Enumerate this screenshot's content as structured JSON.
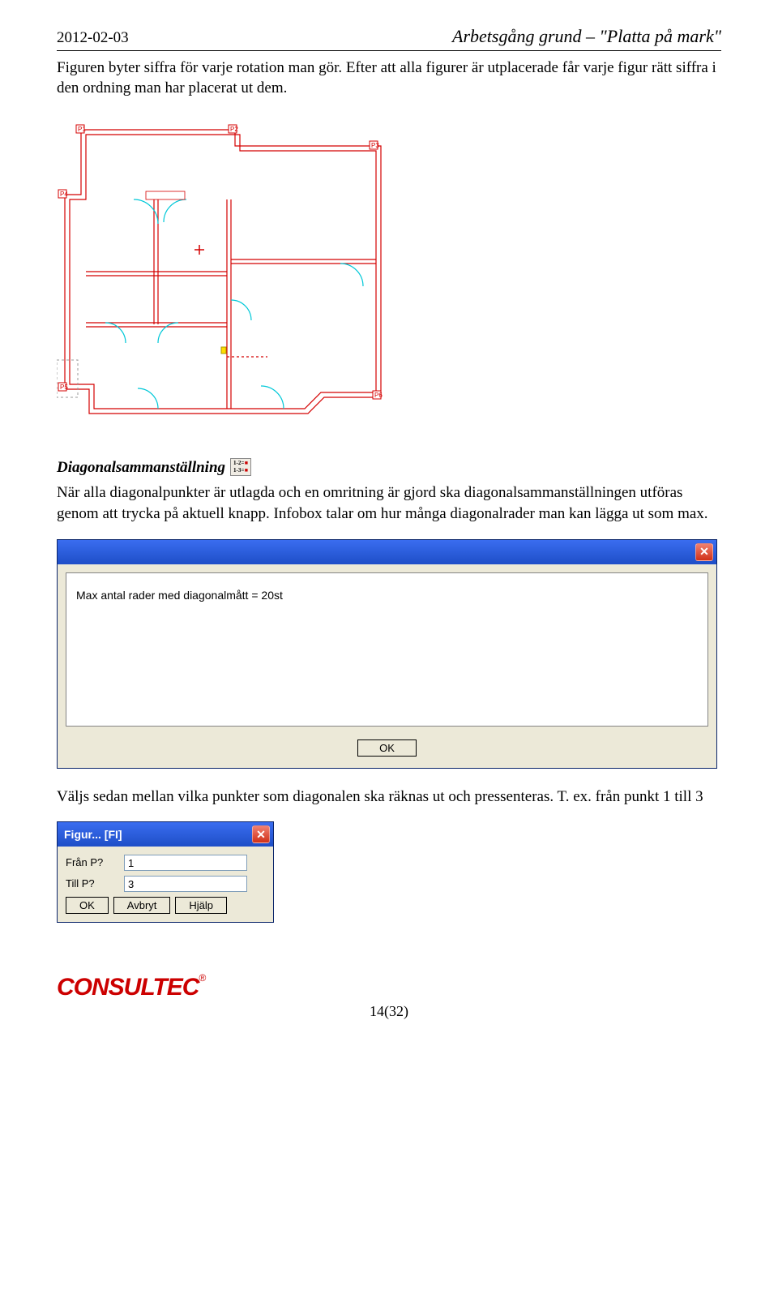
{
  "header": {
    "date": "2012-02-03",
    "title": "Arbetsgång grund – \"Platta på mark\""
  },
  "para1": "Figuren byter siffra för varje rotation man gör. Efter att alla  figurer är utplacerade får varje figur rätt siffra i den ordning man har placerat ut dem.",
  "section2": {
    "title": "Diagonalsammanställning",
    "text": "När alla diagonalpunkter är utlagda och en omritning är gjord ska diagonalsammanställningen utföras genom att trycka på aktuell knapp. Infobox talar om hur många diagonalrader man kan lägga ut som max."
  },
  "msgbox": {
    "text": "Max antal rader med diagonalmått = 20st",
    "ok": "OK"
  },
  "para3": "Väljs sedan mellan vilka punkter som diagonalen ska räknas ut och pressenteras. T. ex. från punkt 1 till 3",
  "figurbox": {
    "title": "Figur...   [FI]",
    "label_from": "Från P?",
    "label_to": "Till P?",
    "val_from": "1",
    "val_to": "3",
    "btn_ok": "OK",
    "btn_cancel": "Avbryt",
    "btn_help": "Hjälp"
  },
  "footer": {
    "logo_text": "CONSULTEC",
    "page": "14(32)"
  }
}
